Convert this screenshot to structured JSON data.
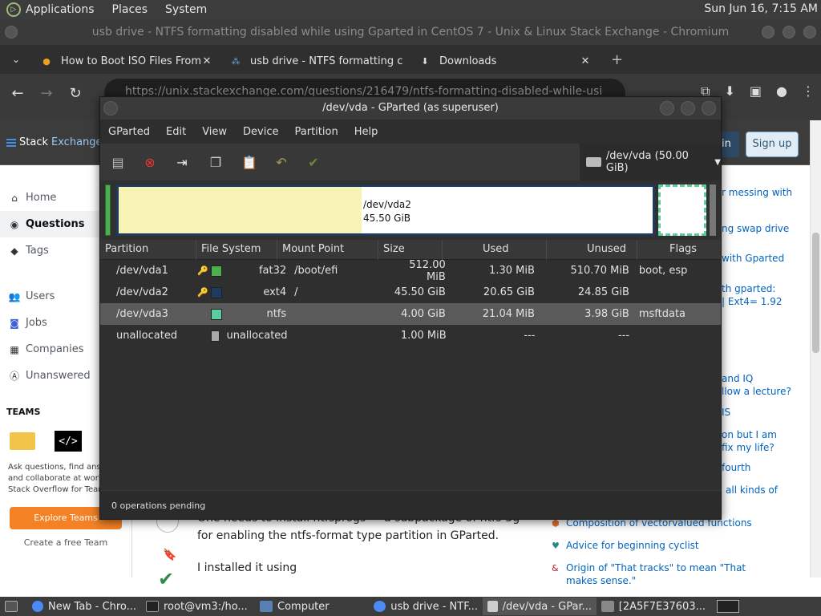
{
  "top_panel": {
    "menus": [
      "Applications",
      "Places",
      "System"
    ],
    "clock": "Sun Jun 16,  7:15 AM"
  },
  "chrome": {
    "window_title": "usb drive - NTFS formatting disabled while using Gparted in CentOS 7 - Unix & Linux Stack Exchange - Chromium",
    "tabs": [
      {
        "title": "How to Boot ISO Files From G",
        "icon": "tab-favicon-icon"
      },
      {
        "title": "usb drive - NTFS formatting c",
        "icon": "stackexchange-icon"
      },
      {
        "title": "Downloads",
        "icon": "download-icon"
      }
    ],
    "url": "https://unix.stackexchange.com/questions/216479/ntfs-formatting-disabled-while-usi"
  },
  "se": {
    "logo_text_1": "Stack",
    "logo_text_2": "Exchange",
    "login_label": "in",
    "signup_label": "Sign up",
    "nav": {
      "home": "Home",
      "questions": "Questions",
      "tags": "Tags",
      "users": "Users",
      "jobs": "Jobs",
      "companies": "Companies",
      "unanswered": "Unanswered"
    },
    "teams_label": "TEAMS",
    "teams_text": "Ask questions, find answers and collaborate at work with Stack Overflow for Teams.",
    "explore_teams": "Explore Teams",
    "create_team": "Create a free Team",
    "body_line_1": "One needs to install ntfsprogs — a subpackage of ntfs-3g",
    "body_line_2": "for enabling the ntfs-format type partition in GParted.",
    "body_line_3": "I installed it using",
    "sidebar_fragments": [
      "r messing with",
      "ng swap drive",
      "with Gparted",
      "th gparted:",
      "| Ext4= 1.92",
      "and IQ",
      "llow a lecture?",
      "IS",
      "on but I am",
      "fix my life?",
      "fourth",
      "all kinds of"
    ],
    "hot_questions": [
      "Composition of vectorvalued functions",
      "Advice for beginning cyclist",
      "Origin of \"That tracks\" to mean \"That makes sense.\""
    ]
  },
  "gparted": {
    "title": "/dev/vda - GParted (as superuser)",
    "menus": [
      "GParted",
      "Edit",
      "View",
      "Device",
      "Partition",
      "Help"
    ],
    "device": "/dev/vda (50.00 GiB)",
    "map_label_name": "/dev/vda2",
    "map_label_size": "45.50 GiB",
    "columns": [
      "Partition",
      "File System",
      "Mount Point",
      "Size",
      "Used",
      "Unused",
      "Flags"
    ],
    "rows": [
      {
        "partition": "/dev/vda1",
        "key": true,
        "fs": "fat32",
        "color": "#4caf50",
        "mount": "/boot/efi",
        "size": "512.00 MiB",
        "used": "1.30 MiB",
        "unused": "510.70 MiB",
        "flags": "boot, esp",
        "selected": false
      },
      {
        "partition": "/dev/vda2",
        "key": true,
        "fs": "ext4",
        "color": "#1f3a5f",
        "mount": "/",
        "size": "45.50 GiB",
        "used": "20.65 GiB",
        "unused": "24.85 GiB",
        "flags": "",
        "selected": false
      },
      {
        "partition": "/dev/vda3",
        "key": false,
        "fs": "ntfs",
        "color": "#5ecba0",
        "mount": "",
        "size": "4.00 GiB",
        "used": "21.04 MiB",
        "unused": "3.98 GiB",
        "flags": "msftdata",
        "selected": true
      },
      {
        "partition": "unallocated",
        "key": false,
        "fs": "unallocated",
        "color": "#a8a8a8",
        "mount": "",
        "size": "1.00 MiB",
        "used": "---",
        "unused": "---",
        "flags": "",
        "selected": false
      }
    ],
    "status": "0 operations pending"
  },
  "taskbar": {
    "items": [
      {
        "label": "New Tab - Chro...",
        "icon": "chromium-icon",
        "active": false
      },
      {
        "label": "root@vm3:/ho...",
        "icon": "terminal-icon",
        "active": false
      },
      {
        "label": "Computer",
        "icon": "computer-icon",
        "active": false
      },
      {
        "label": "usb drive - NTF...",
        "icon": "chromium-icon",
        "active": false
      },
      {
        "label": "/dev/vda - GPar...",
        "icon": "gparted-icon",
        "active": true
      },
      {
        "label": "[2A5F7E37603...",
        "icon": "window-icon",
        "active": false
      }
    ]
  }
}
